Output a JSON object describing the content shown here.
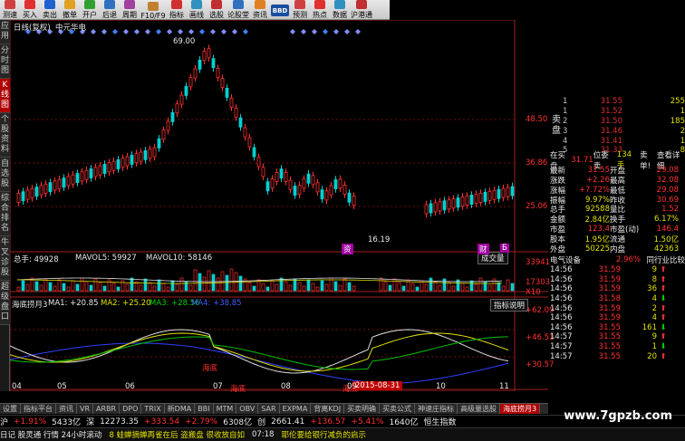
{
  "toolbar": [
    {
      "label": "测速",
      "icon": "speed-icon",
      "color": "#d04040"
    },
    {
      "label": "买入",
      "icon": "buy-icon",
      "color": "#e03030"
    },
    {
      "label": "卖出",
      "icon": "sell-icon",
      "color": "#2060d0"
    },
    {
      "label": "撤单",
      "icon": "cancel-icon",
      "color": "#e0a020"
    },
    {
      "label": "开户",
      "icon": "account-icon",
      "color": "#30a030"
    },
    {
      "label": "后退",
      "icon": "back-icon",
      "color": "#3070c0"
    },
    {
      "label": "周期",
      "icon": "period-icon",
      "color": "#a040a0"
    },
    {
      "label": "F10/F9",
      "icon": "f10-icon",
      "color": "#c08030"
    },
    {
      "label": "指标",
      "icon": "indicator-icon",
      "color": "#d03030"
    },
    {
      "label": "画线",
      "icon": "draw-icon",
      "color": "#3090c0"
    },
    {
      "label": "选股",
      "icon": "pick-icon",
      "color": "#c03030"
    },
    {
      "label": "论股堂",
      "icon": "forum-icon",
      "color": "#3070c0"
    },
    {
      "label": "资讯",
      "icon": "news-icon",
      "color": "#e08020"
    },
    {
      "label": "BBD",
      "icon": "bbd-icon",
      "color": "#1a4ea0"
    },
    {
      "label": "预测",
      "icon": "forecast-icon",
      "color": "#d04040"
    },
    {
      "label": "热点",
      "icon": "hot-icon",
      "color": "#e03030"
    },
    {
      "label": "数据",
      "icon": "data-icon",
      "color": "#3090c0"
    },
    {
      "label": "沪港通",
      "icon": "hk-icon",
      "color": "#c03030"
    }
  ],
  "side_tabs": [
    "应用",
    "分时图",
    "K线图",
    "个股资料",
    "自选股",
    "综合排名",
    "牛叉诊股",
    "超级盘口"
  ],
  "chart_header": {
    "period": "日线(复权)",
    "name": "中元华电"
  },
  "price_axis": [
    "48.50",
    "36.86",
    "25.06"
  ],
  "price_marks": {
    "high": "69.00",
    "low": "16.19"
  },
  "volume_header": {
    "total": "总手: 49928",
    "ma5": "MAVOL5: 59927",
    "ma10": "MAVOL10: 58146"
  },
  "volume_axis": [
    "33941",
    "17303",
    "X10"
  ],
  "volume_button": "成交量",
  "indicator_header": {
    "name": "海底捞月3",
    "ma1": "MA1: +20.85",
    "ma2": "MA2: +25.20",
    "ma3": "MA3: +28.56",
    "ma4": "MA4: +38.85"
  },
  "indicator_button": "指标说明",
  "indicator_axis": [
    "+62.09",
    "+46.51",
    "+30.57"
  ],
  "indicator_marks": [
    "海底",
    "海底",
    "海底"
  ],
  "date_axis": [
    "04",
    "05",
    "06",
    "07",
    "08",
    "09",
    "10",
    "11"
  ],
  "date_cursor": "2015-08-31",
  "news_badges": [
    "资",
    "财",
    "Б"
  ],
  "order_book": {
    "sell_label": "卖盘",
    "buy_label": "买盘",
    "sell": [
      {
        "lvl": "1",
        "price": "31.55",
        "vol": "255"
      },
      {
        "lvl": "1",
        "price": "31.52",
        "vol": "1"
      },
      {
        "lvl": "2",
        "price": "31.50",
        "vol": "185"
      },
      {
        "lvl": "3",
        "price": "31.46",
        "vol": "2"
      },
      {
        "lvl": "4",
        "price": "31.41",
        "vol": "1"
      }
    ],
    "buy": [
      {
        "lvl": "5",
        "price": "31.33",
        "vol": "8"
      }
    ]
  },
  "order_summary": {
    "label": "在买盘",
    "price": "31.71",
    "tag": "位委卖",
    "count": "134手",
    "sell": "卖单!",
    "detail": "查看详细"
  },
  "stats": [
    {
      "k1": "最新",
      "v1": "31.55",
      "k2": "开盘",
      "v2": "29.08"
    },
    {
      "k1": "涨跌",
      "v1": "+2.26",
      "k2": "最高",
      "v2": "32.08"
    },
    {
      "k1": "涨幅",
      "v1": "+7.72%",
      "k2": "最低",
      "v2": "29.08"
    },
    {
      "k1": "振幅",
      "v1": "9.97%",
      "k2": "昨收",
      "v2": "30.69"
    },
    {
      "k1": "总手",
      "v1": "92588",
      "k2": "量比",
      "v2": "1.52"
    },
    {
      "k1": "金额",
      "v1": "2.84亿",
      "k2": "换手",
      "v2": "6.17%"
    },
    {
      "k1": "市盈",
      "v1": "123.4",
      "k2": "市盈(动)",
      "v2": "146.4"
    },
    {
      "k1": "股本",
      "v1": "1.95亿",
      "k2": "流通",
      "v2": "1.50亿"
    },
    {
      "k1": "外盘",
      "v1": "50225",
      "k2": "内盘",
      "v2": "42363"
    }
  ],
  "sector": {
    "name": "电气设备",
    "change": "2.96%",
    "compare": "同行业比较"
  },
  "ticks": [
    {
      "time": "14:56",
      "price": "31.59",
      "vol": "9",
      "dir": "up"
    },
    {
      "time": "14:56",
      "price": "31.59",
      "vol": "8",
      "dir": "up"
    },
    {
      "time": "14:56",
      "price": "31.59",
      "vol": "36",
      "dir": "up"
    },
    {
      "time": "14:56",
      "price": "31.58",
      "vol": "4",
      "dir": "down"
    },
    {
      "time": "14:56",
      "price": "31.59",
      "vol": "2",
      "dir": "up"
    },
    {
      "time": "14:56",
      "price": "31.59",
      "vol": "4",
      "dir": "up"
    },
    {
      "time": "14:56",
      "price": "31.55",
      "vol": "161",
      "dir": "down"
    },
    {
      "time": "14:57",
      "price": "31.55",
      "vol": "9",
      "dir": "up"
    },
    {
      "time": "14:57",
      "price": "31.55",
      "vol": "1",
      "dir": "down"
    },
    {
      "time": "14:57",
      "price": "31.55",
      "vol": "20",
      "dir": "up"
    }
  ],
  "bottom_tabs": [
    "设置",
    "指标平台",
    "资讯",
    "VR",
    "ARBR",
    "DPO",
    "TRIX",
    "新DMA",
    "BBI",
    "MTM",
    "OBV",
    "SAR",
    "EXPMA",
    "背离KDJ",
    "买卖明确",
    "买卖公式",
    "神速庄指标",
    "高级量选股",
    "海底捞月3"
  ],
  "index_bar": [
    {
      "text": "沪",
      "cls": "white"
    },
    {
      "text": "+1.91%",
      "cls": "red"
    },
    {
      "text": "5433亿",
      "cls": "white"
    },
    {
      "text": "深",
      "cls": "white"
    },
    {
      "text": "12273.35",
      "cls": "white"
    },
    {
      "text": "+333.54",
      "cls": "red"
    },
    {
      "text": "+2.79%",
      "cls": "red"
    },
    {
      "text": "6308亿",
      "cls": "white"
    },
    {
      "text": "创",
      "cls": "white"
    },
    {
      "text": "2661.41",
      "cls": "white"
    },
    {
      "text": "+136.57",
      "cls": "red"
    },
    {
      "text": "+5.41%",
      "cls": "red"
    },
    {
      "text": "1640亿",
      "cls": "white"
    },
    {
      "text": "恒生指数",
      "cls": "white"
    }
  ],
  "status_bar": {
    "left": "日记 股灵通 行情 24小时滚动",
    "ticker": "8 蛙蝉摘蝉再雀在后 盗搬盘 很收放自如",
    "time": "07:18",
    "news": "耶伦要给银行减负的启示"
  },
  "watermark": "www.7gpzb.com"
}
